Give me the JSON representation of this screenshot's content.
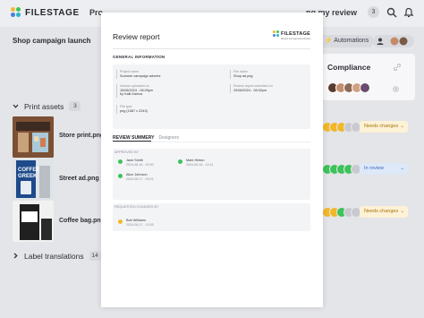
{
  "app": {
    "logo_text": "FILESTAGE",
    "nav_projects_label": "Pro",
    "nav_review_label": "ng my review",
    "review_count": "3"
  },
  "project": {
    "title": "Shop campaign launch",
    "automations_label": "Automations",
    "compliance_title": "Compliance"
  },
  "sections": [
    {
      "title": "Print assets",
      "count": "3"
    },
    {
      "title": "Label translations",
      "count": "14"
    }
  ],
  "files": [
    {
      "name": "Store print.png",
      "status": "Needs changes"
    },
    {
      "name": "Street ad.png",
      "status": "In review"
    },
    {
      "name": "Coffee bag.png",
      "status": "Needs changes"
    }
  ],
  "colors": {
    "approved": "#3cc35a",
    "needs_changes": "#f2b827",
    "in_review": "#4a7fd6",
    "pending": "#c8cad0"
  },
  "report": {
    "title": "Review report",
    "logo_text": "FILESTAGE",
    "logo_subtext": "Review and approval software",
    "general_label": "GENERAL INFORMATION",
    "fields": {
      "project_name_label": "Project name",
      "project_name_value": "Summer campaign adverts",
      "file_name_label": "File name",
      "file_name_value": "Shop ad.png",
      "version_label": "Version uploaded on",
      "version_value": "15/08/2024 - 08:25pm",
      "version_by": "by Kalli Damos",
      "submitted_label": "Review report submitted on",
      "submitted_value": "29/08/2024 - 08:32pm",
      "file_type_label": "File type",
      "file_type_value": "png (1587 x 2243)"
    },
    "tabs": {
      "summary_label": "REVIEW SUMMERY",
      "designers_label": "Designers"
    },
    "approved_label": "APPROVED BY",
    "approvers": [
      {
        "name": "Jane Smith",
        "date": "2024-08-16 - 09:30"
      },
      {
        "name": "Mark Hinton",
        "date": "2024-08-16 - 10:11"
      },
      {
        "name": "Alice Johnson",
        "date": "2024-08-17 - 09:21"
      }
    ],
    "requested_label": "REQUESTED CHANGES BY",
    "requesters": [
      {
        "name": "Bob Williams",
        "date": "2024-08-17 - 10:05"
      }
    ]
  }
}
